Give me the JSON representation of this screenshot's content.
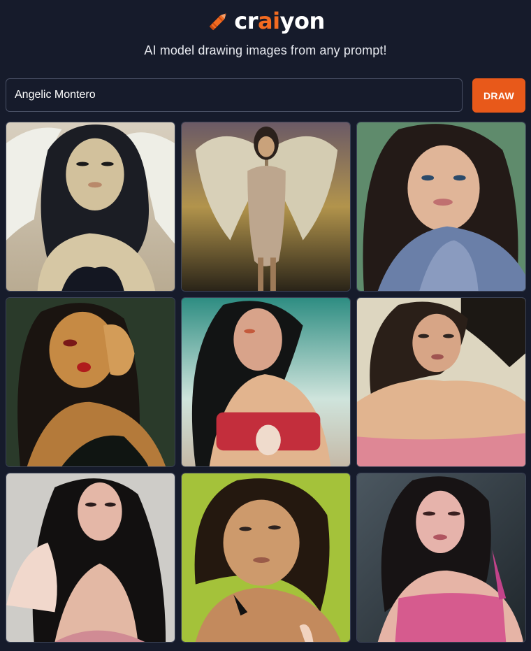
{
  "header": {
    "logo_prefix": "cr",
    "logo_accent": "ai",
    "logo_suffix": "yon",
    "tagline": "AI model drawing images from any prompt!"
  },
  "prompt": {
    "value": "Angelic Montero",
    "button_label": "DRAW"
  },
  "colors": {
    "background": "#161b2b",
    "accent": "#e8591a",
    "border": "#3b4256"
  },
  "results": [
    {
      "icon": "generated-image",
      "style": "angel-illustration"
    },
    {
      "icon": "generated-image",
      "style": "angel-wings-dress"
    },
    {
      "icon": "generated-image",
      "style": "blue-sweater-portrait"
    },
    {
      "icon": "generated-image",
      "style": "dark-green-portrait"
    },
    {
      "icon": "generated-image",
      "style": "red-top-teal-background"
    },
    {
      "icon": "generated-image",
      "style": "pink-top-beige-background"
    },
    {
      "icon": "generated-image",
      "style": "gray-background-portrait"
    },
    {
      "icon": "generated-image",
      "style": "green-background-portrait"
    },
    {
      "icon": "generated-image",
      "style": "pink-top-dark-background"
    }
  ]
}
